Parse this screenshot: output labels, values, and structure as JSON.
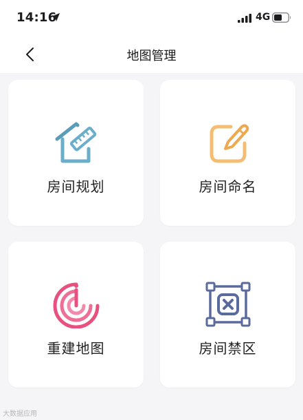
{
  "status_bar": {
    "time": "14:16",
    "network": "4G",
    "icons": [
      "location-arrow-icon",
      "signal-icon",
      "battery-icon"
    ]
  },
  "nav": {
    "title": "地图管理",
    "back_icon": "chevron-left-icon"
  },
  "menu": {
    "items": [
      {
        "label": "房间规划",
        "icon": "room-planning-icon",
        "color": "#6aaec9"
      },
      {
        "label": "房间命名",
        "icon": "room-naming-icon",
        "color": "#f0b15a"
      },
      {
        "label": "重建地图",
        "icon": "rebuild-map-icon",
        "color": "#e85786"
      },
      {
        "label": "房间禁区",
        "icon": "restricted-zone-icon",
        "color": "#5a6a9c"
      }
    ]
  },
  "watermark": "大数据应用"
}
